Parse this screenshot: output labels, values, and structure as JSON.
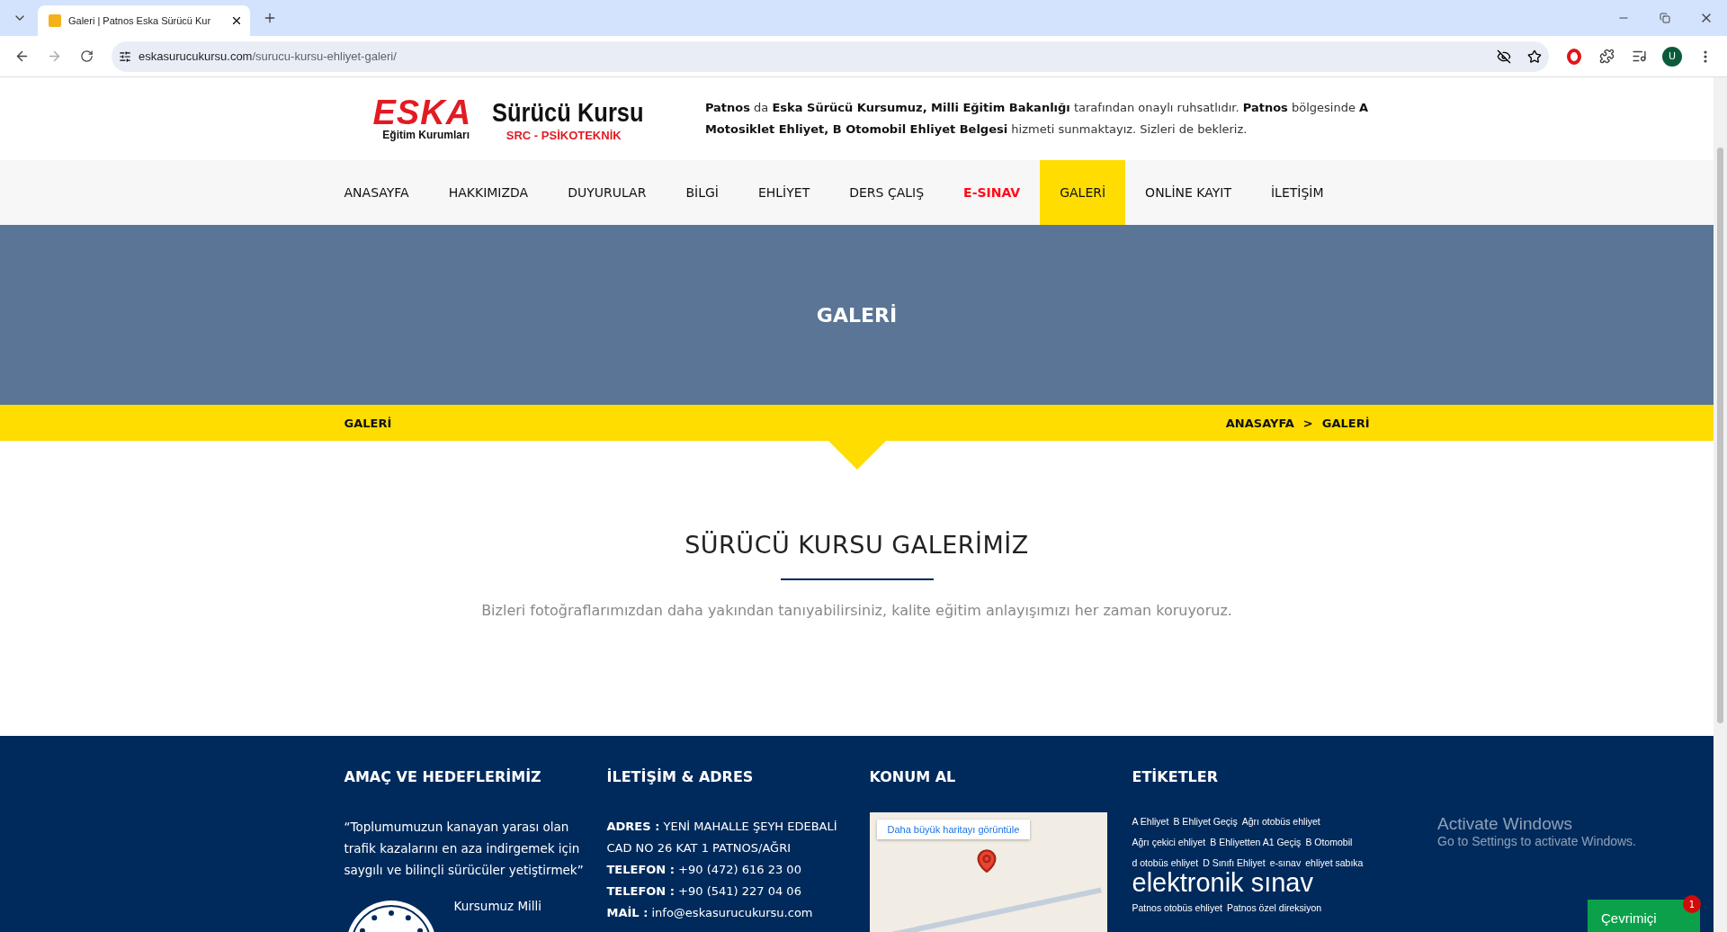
{
  "browser": {
    "tab_title": "Galeri | Patnos Eska Sürücü Kur",
    "url_domain": "eskasurucukursu.com",
    "url_path": "/surucu-kursu-ehliyet-galeri/",
    "profile_initial": "U"
  },
  "header": {
    "logo": {
      "brand": "ESKA",
      "subtitle": "Eğitim Kurumları",
      "name": "Sürücü Kursu",
      "tagline": "SRC - PSİKOTEKNİK"
    },
    "intro": "**Patnos** da **Eska Sürücü Kursumuz, Milli Eğitim Bakanlığı** tarafından onaylı ruhsatlıdır. **Patnos** bölgesinde **A Motosiklet Ehliyet, B Otomobil Ehliyet Belgesi** hizmeti sunmaktayız. Sizleri de bekleriz."
  },
  "nav": [
    {
      "label": "ANASAYFA",
      "selected": false,
      "kind": "plain"
    },
    {
      "label": "HAKKIMIZDA",
      "selected": false,
      "kind": "plain"
    },
    {
      "label": "DUYURULAR",
      "selected": false,
      "kind": "plain"
    },
    {
      "label": "BİLGİ",
      "selected": false,
      "kind": "plain"
    },
    {
      "label": "EHLİYET",
      "selected": false,
      "kind": "plain"
    },
    {
      "label": "DERS ÇALIŞ",
      "selected": false,
      "kind": "plain"
    },
    {
      "label": "E-SINAV",
      "selected": false,
      "kind": "accent"
    },
    {
      "label": "GALERİ",
      "selected": true,
      "kind": "plain"
    },
    {
      "label": "ONLİNE KAYIT",
      "selected": false,
      "kind": "plain"
    },
    {
      "label": "İLETİŞİM",
      "selected": false,
      "kind": "plain"
    }
  ],
  "hero": {
    "title": "GALERİ"
  },
  "breadcrumb_bar": {
    "page": "GALERİ",
    "trail": [
      "ANASAYFA",
      "GALERİ"
    ],
    "separator": ">"
  },
  "section": {
    "title": "SÜRÜCÜ KURSU GALERİMİZ",
    "subtitle": "Bizleri fotoğraflarımızdan daha yakından tanıyabilirsiniz, kalite eğitim anlayışımızı her zaman koruyoruz."
  },
  "footer": {
    "columns": [
      {
        "kind": "about",
        "heading": "AMAÇ VE HEDEFLERİMİZ",
        "quote": "“Toplumumuzun kanayan yarası olan trafik kazalarını en aza indirgemek için saygılı ve bilinçli sürücüler yetiştirmek”",
        "note": "Kursumuz Milli"
      },
      {
        "kind": "contact",
        "heading": "İLETİŞİM & ADRES",
        "lines": [
          {
            "label": "ADRES :",
            "value": "YENİ MAHALLE ŞEYH EDEBALİ CAD NO 26 KAT 1 PATNOS/AĞRI"
          },
          {
            "label": "TELEFON :",
            "value": "+90 (472) 616 23 00"
          },
          {
            "label": "TELEFON :",
            "value": "+90 (541) 227 04 06"
          },
          {
            "label": "MAİL :",
            "value": "info@eskasurucukursu.com"
          }
        ]
      },
      {
        "kind": "map",
        "heading": "KONUM AL",
        "map_link": "Daha büyük haritayı görüntüle"
      },
      {
        "kind": "tags",
        "heading": "ETİKETLER",
        "tags": [
          {
            "label": "A Ehliyet",
            "kind": "small"
          },
          {
            "label": "B Ehliyet Geçiş",
            "kind": "small"
          },
          {
            "label": "Ağrı otobüs ehliyet",
            "kind": "small"
          },
          {
            "label": "Ağrı çekici ehliyet",
            "kind": "small"
          },
          {
            "label": "B Ehliyetten A1 Geçiş",
            "kind": "small"
          },
          {
            "label": "B Otomobil",
            "kind": "small"
          },
          {
            "label": "d otobüs ehliyet",
            "kind": "small"
          },
          {
            "label": "D Sınıfı Ehliyet",
            "kind": "small"
          },
          {
            "label": "e-sınav",
            "kind": "small"
          },
          {
            "label": "ehliyet sabıka",
            "kind": "small"
          },
          {
            "label": "elektronik sınav",
            "kind": "big"
          },
          {
            "label": "Patnos otobüs ehliyet",
            "kind": "small"
          },
          {
            "label": "Patnos özel direksiyon",
            "kind": "small"
          }
        ]
      }
    ]
  },
  "os_notice": {
    "title": "Activate Windows",
    "text": "Go to Settings to activate Windows."
  },
  "chat": {
    "label": "Çevrimiçi",
    "badge": "1"
  }
}
